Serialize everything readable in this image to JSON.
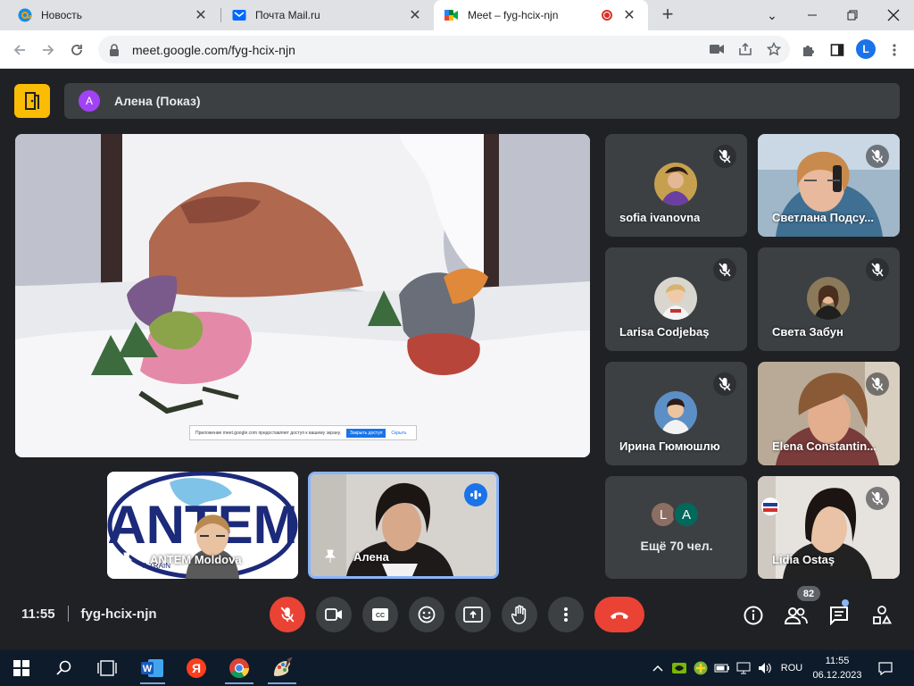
{
  "browser": {
    "tabs": [
      {
        "title": "Новость",
        "favicon": "mail-ru-at-icon"
      },
      {
        "title": "Почта Mail.ru",
        "favicon": "mail-envelope-icon"
      },
      {
        "title": "Meet – fyg-hcix-njn",
        "favicon": "google-meet-icon",
        "active": true,
        "recording": true
      }
    ],
    "url": "meet.google.com/fyg-hcix-njn",
    "profile_initial": "L"
  },
  "meet": {
    "presenter": {
      "initial": "A",
      "name": "Алена (Показ)"
    },
    "presentation_banner": {
      "text": "Приложение meet.google.com предоставляет доступ к вашему экрану.",
      "stop_label": "Закрыть доступ",
      "hide_label": "Скрыть"
    },
    "participants": [
      {
        "name": "sofia ivanovna",
        "muted": true
      },
      {
        "name": "Светлана Подсу...",
        "muted": true
      },
      {
        "name": "Larisa Codjebaş",
        "muted": true
      },
      {
        "name": "Света Забун",
        "muted": true
      },
      {
        "name": "Ирина Гюмюшлю",
        "muted": true
      },
      {
        "name": "Elena Constantin...",
        "muted": true
      },
      {
        "name": "Lidia Ostaş",
        "muted": true
      }
    ],
    "more": {
      "initials": [
        "L",
        "A"
      ],
      "label": "Ещё 70 чел."
    },
    "pinned": [
      {
        "name": "ANTEM Moldova",
        "logo_text": "ANTEM",
        "tagline": "A TRAIN"
      },
      {
        "name": "Алена",
        "speaking": true
      }
    ],
    "time": "11:55",
    "meeting_code": "fyg-hcix-njn",
    "participant_count": "82"
  },
  "taskbar": {
    "language": "ROU",
    "time": "11:55",
    "date": "06.12.2023"
  },
  "colors": {
    "meet_bg": "#202124",
    "tile_bg": "#3c4043",
    "danger": "#ea4335",
    "accent_yellow": "#fbbc04",
    "accent_blue": "#8ab4f8"
  }
}
